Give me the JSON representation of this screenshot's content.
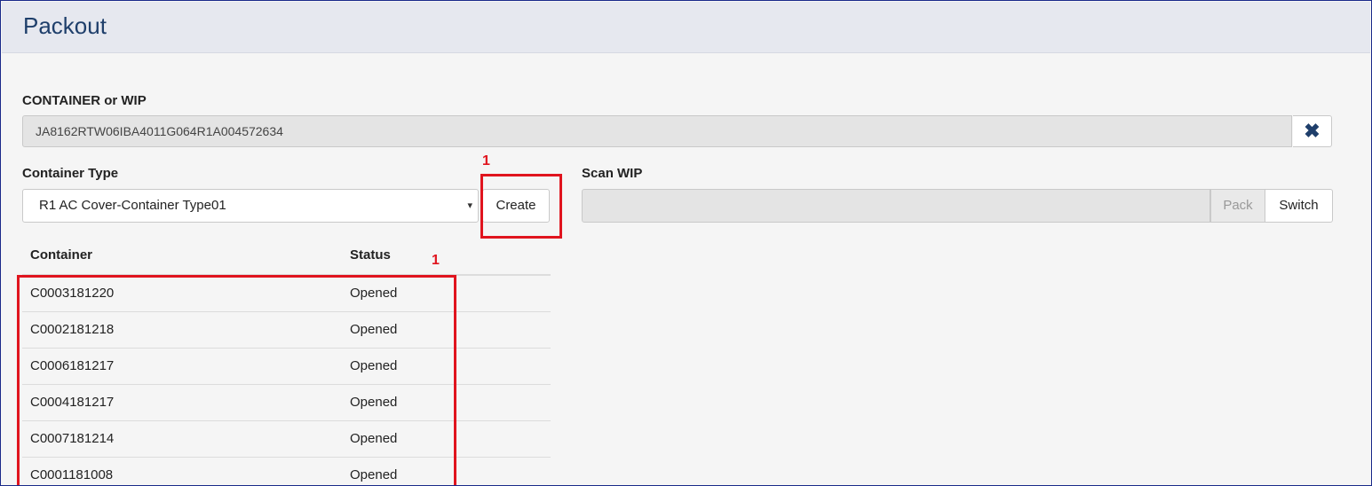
{
  "header": {
    "title": "Packout"
  },
  "container_or_wip": {
    "label": "CONTAINER or WIP",
    "value": "JA8162RTW06IBA4011G064R1A004572634",
    "clear_icon": "close-icon"
  },
  "container_type": {
    "label": "Container Type",
    "selected": "R1 AC Cover-Container Type01",
    "caret": "▾",
    "create_label": "Create"
  },
  "scan_wip": {
    "label": "Scan WIP",
    "value": "",
    "pack_label": "Pack",
    "switch_label": "Switch"
  },
  "table": {
    "headers": [
      "Container",
      "Status"
    ],
    "rows": [
      [
        "C0003181220",
        "Opened"
      ],
      [
        "C0002181218",
        "Opened"
      ],
      [
        "C0006181217",
        "Opened"
      ],
      [
        "C0004181217",
        "Opened"
      ],
      [
        "C0007181214",
        "Opened"
      ],
      [
        "C0001181008",
        "Opened"
      ]
    ]
  },
  "annotations": {
    "create_marker": "1",
    "list_marker": "1",
    "highlight_color": "#e0141e"
  }
}
